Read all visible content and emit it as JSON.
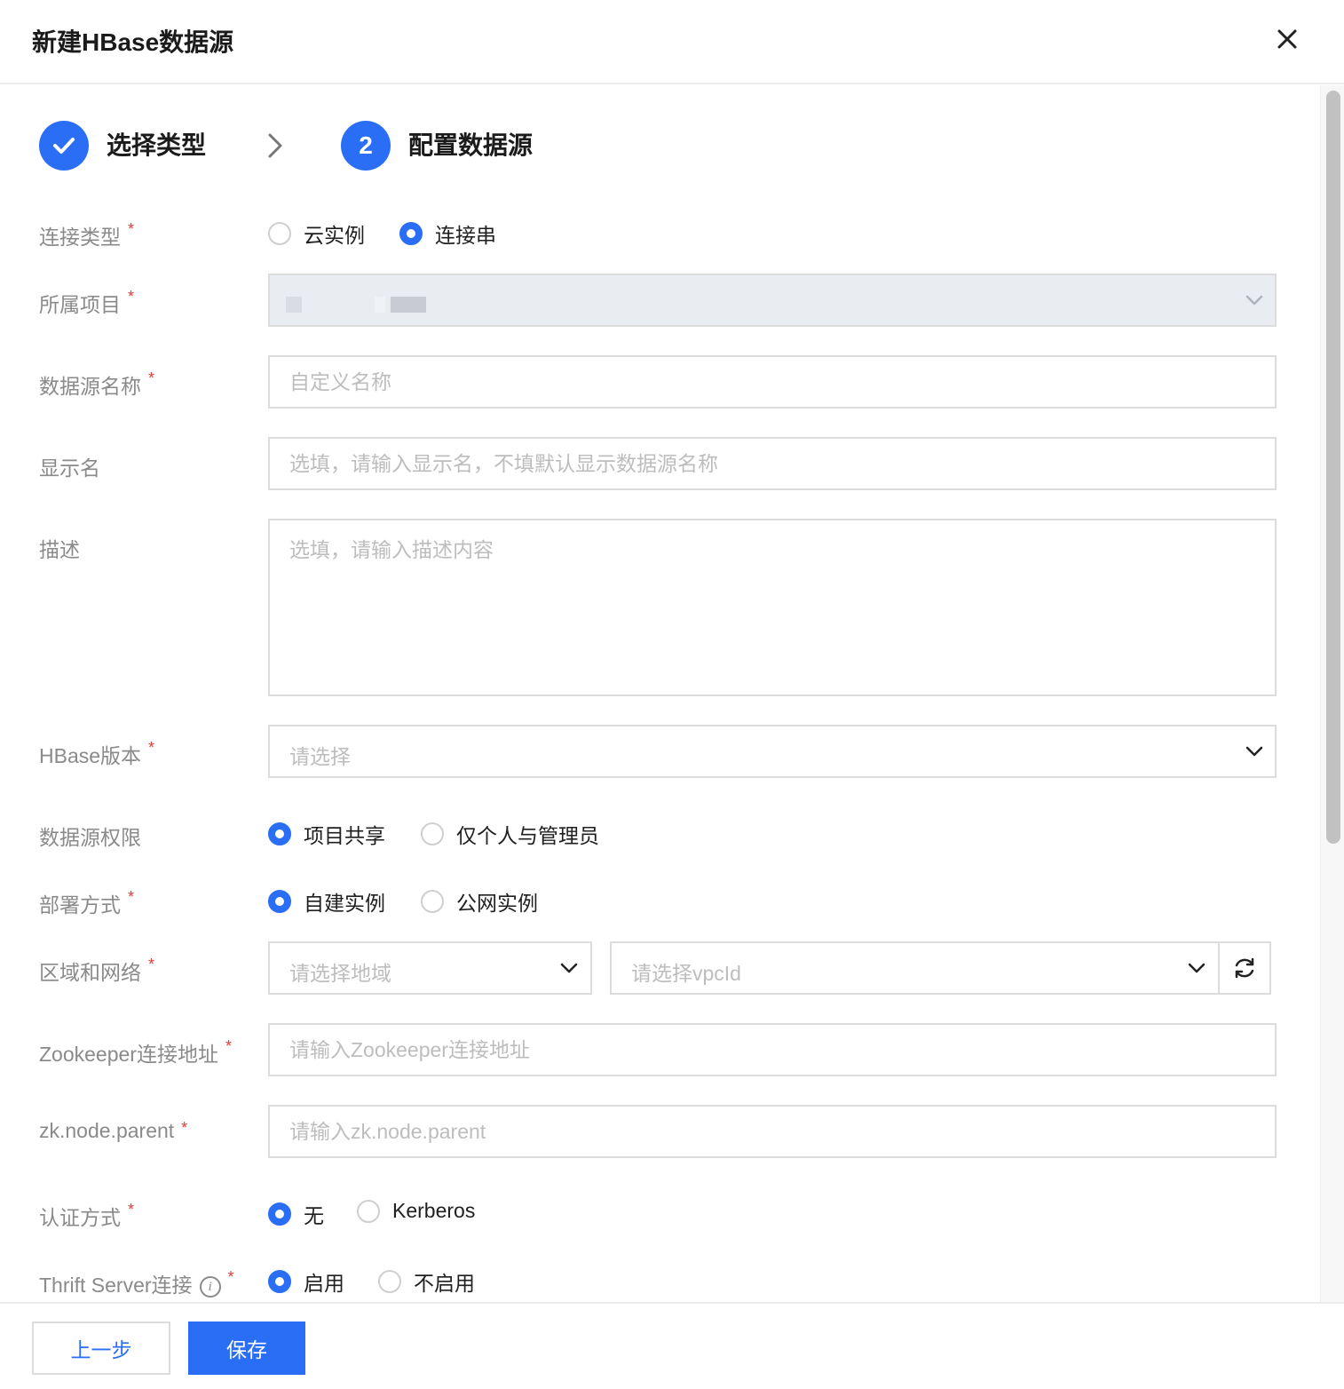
{
  "dialog": {
    "title": "新建HBase数据源"
  },
  "steps": [
    {
      "label": "选择类型",
      "status": "done"
    },
    {
      "number": "2",
      "label": "配置数据源",
      "status": "active"
    }
  ],
  "form": {
    "connection_type": {
      "label": "连接类型",
      "options": [
        "云实例",
        "连接串"
      ],
      "selected": "连接串"
    },
    "project": {
      "label": "所属项目"
    },
    "name": {
      "label": "数据源名称",
      "placeholder": "自定义名称"
    },
    "display_name": {
      "label": "显示名",
      "placeholder": "选填，请输入显示名，不填默认显示数据源名称"
    },
    "description": {
      "label": "描述",
      "placeholder": "选填，请输入描述内容"
    },
    "version": {
      "label": "HBase版本",
      "placeholder": "请选择"
    },
    "permission": {
      "label": "数据源权限",
      "options": [
        "项目共享",
        "仅个人与管理员"
      ],
      "selected": "项目共享"
    },
    "deploy": {
      "label": "部署方式",
      "options": [
        "自建实例",
        "公网实例"
      ],
      "selected": "自建实例"
    },
    "region": {
      "label": "区域和网络",
      "region_placeholder": "请选择地域",
      "vpc_placeholder": "请选择vpcId"
    },
    "zookeeper": {
      "label": "Zookeeper连接地址",
      "placeholder": "请输入Zookeeper连接地址"
    },
    "zk_parent": {
      "label": "zk.node.parent",
      "placeholder": "请输入zk.node.parent"
    },
    "auth": {
      "label": "认证方式",
      "options": [
        "无",
        "Kerberos"
      ],
      "selected": "无"
    },
    "thrift": {
      "label": "Thrift Server连接",
      "info_icon": "i",
      "options": [
        "启用",
        "不启用"
      ],
      "selected": "启用"
    }
  },
  "required_mark": "*",
  "footer": {
    "prev_label": "上一步",
    "save_label": "保存"
  },
  "colors": {
    "primary": "#2a6ef5",
    "required": "#e23b3b"
  }
}
